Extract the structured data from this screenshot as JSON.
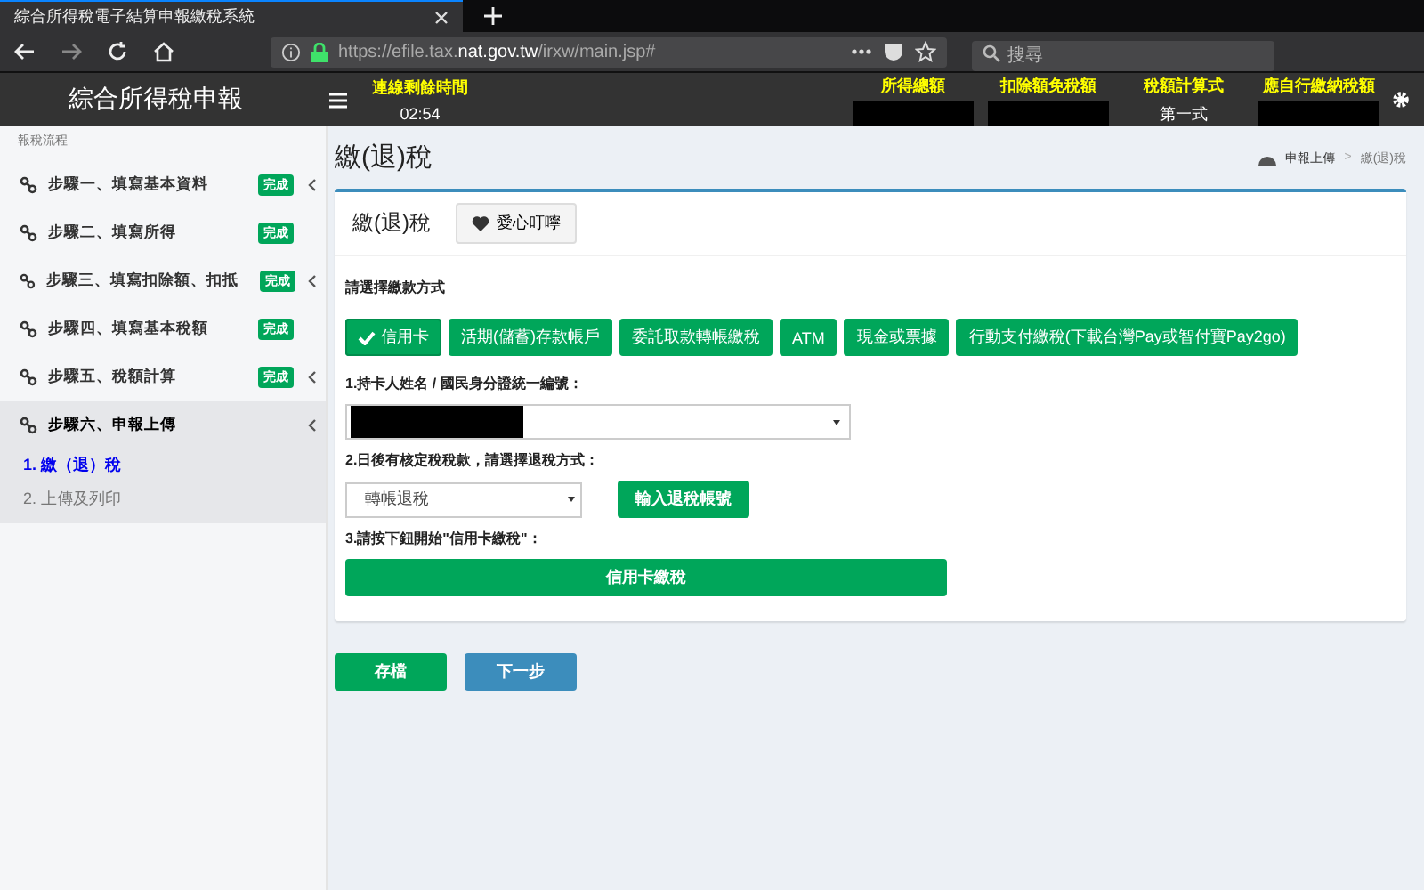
{
  "browser": {
    "tab_title": "綜合所得稅電子結算申報繳稅系統",
    "url_prefix": "https://efile.tax.",
    "url_domain": "nat.gov.tw",
    "url_path": "/irxw/main.jsp#",
    "search_placeholder": "搜尋"
  },
  "header": {
    "app_title": "綜合所得稅申報",
    "timer_label": "連線剩餘時間",
    "timer_value": "02:54",
    "summary": [
      {
        "label": "所得總額"
      },
      {
        "label": "扣除額免稅額"
      },
      {
        "label": "稅額計算式",
        "value": "第一式"
      },
      {
        "label": "應自行繳納稅額"
      }
    ]
  },
  "sidebar": {
    "heading": "報稅流程",
    "items": [
      {
        "label": "步驟一、填寫基本資料",
        "badge": "完成",
        "expandable": true,
        "expanded": false
      },
      {
        "label": "步驟二、填寫所得",
        "badge": "完成",
        "expandable": false,
        "expanded": false
      },
      {
        "label": "步驟三、填寫扣除額、扣抵",
        "badge": "完成",
        "expandable": true,
        "expanded": false
      },
      {
        "label": "步驟四、填寫基本稅額",
        "badge": "完成",
        "expandable": false,
        "expanded": false
      },
      {
        "label": "步驟五、稅額計算",
        "badge": "完成",
        "expandable": true,
        "expanded": false
      },
      {
        "label": "步驟六、申報上傳",
        "expandable": true,
        "expanded": true,
        "children": [
          {
            "label": "1. 繳（退）稅",
            "selected": true
          },
          {
            "label": "2. 上傳及列印",
            "selected": false
          }
        ]
      }
    ]
  },
  "page": {
    "title": "繳(退)稅",
    "breadcrumb": [
      "申報上傳",
      "繳(退)稅"
    ],
    "breadcrumb_separator": ">"
  },
  "card": {
    "title": "繳(退)稅",
    "love_button": "愛心叮嚀",
    "method_prompt": "請選擇繳款方式",
    "methods": [
      {
        "label": "信用卡",
        "selected": true
      },
      {
        "label": "活期(儲蓄)存款帳戶",
        "selected": false
      },
      {
        "label": "委託取款轉帳繳稅",
        "selected": false
      },
      {
        "label": "ATM",
        "selected": false
      },
      {
        "label": "現金或票據",
        "selected": false
      },
      {
        "label": "行動支付繳稅(下載台灣Pay或智付寶Pay2go)",
        "selected": false
      }
    ],
    "q1": "1.持卡人姓名 / 國民身分證統一編號：",
    "q2": "2.日後有核定稅稅款，請選擇退稅方式：",
    "refund_value": "轉帳退稅",
    "refund_button": "輸入退稅帳號",
    "q3": "3.請按下鈕開始\"信用卡繳稅\"：",
    "pay_button": "信用卡繳稅"
  },
  "actions": [
    {
      "label": "存檔",
      "kind": "save"
    },
    {
      "label": "下一步",
      "kind": "next"
    }
  ]
}
